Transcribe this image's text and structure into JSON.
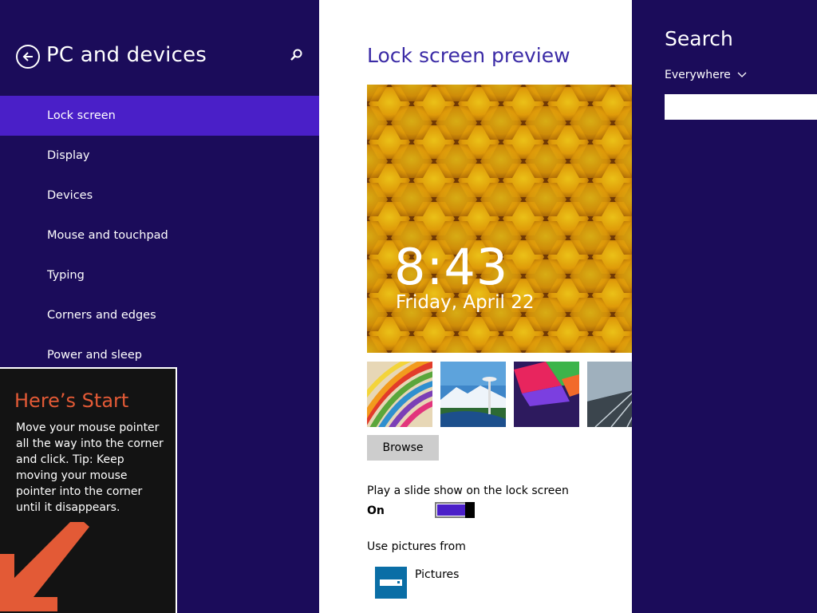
{
  "left_pane": {
    "title": "PC and devices",
    "nav_items": [
      {
        "label": "Lock screen",
        "selected": true
      },
      {
        "label": "Display"
      },
      {
        "label": "Devices"
      },
      {
        "label": "Mouse and touchpad"
      },
      {
        "label": "Typing"
      },
      {
        "label": "Corners and edges"
      },
      {
        "label": "Power and sleep"
      }
    ]
  },
  "tip": {
    "title": "Here’s Start",
    "body": "Move your mouse pointer all the way into the corner and click. Tip: Keep moving your mouse pointer into the corner until it disappears."
  },
  "main": {
    "title": "Lock screen preview",
    "preview_time": "8:43",
    "preview_date": "Friday, April 22",
    "browse_label": "Browse",
    "slideshow_label": "Play a slide show on the lock screen",
    "slideshow_state": "On",
    "use_pictures_label": "Use pictures from",
    "pictures_source": "Pictures"
  },
  "search": {
    "title": "Search",
    "scope": "Everywhere",
    "placeholder": ""
  },
  "colors": {
    "pane_bg": "#1b0c5a",
    "accent": "#4a1fc8",
    "tip_title": "#e35a36"
  },
  "icons": [
    "back-arrow-icon",
    "search-icon",
    "chevron-down-icon",
    "pictures-folder-icon",
    "corner-arrow-icon"
  ]
}
